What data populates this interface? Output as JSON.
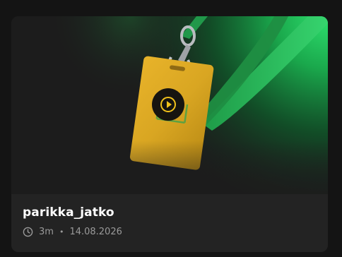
{
  "video": {
    "title": "parikka_jatko",
    "duration": "3m",
    "separator": "•",
    "date": "14.08.2026",
    "play_icon": "play-icon",
    "clock_icon": "clock-icon"
  },
  "colors": {
    "background": "#141414",
    "card": "#232323",
    "accent_yellow": "#f1c21b",
    "lanyard_green": "#2fd26a",
    "title": "#ffffff",
    "meta": "#9a9a9a"
  }
}
